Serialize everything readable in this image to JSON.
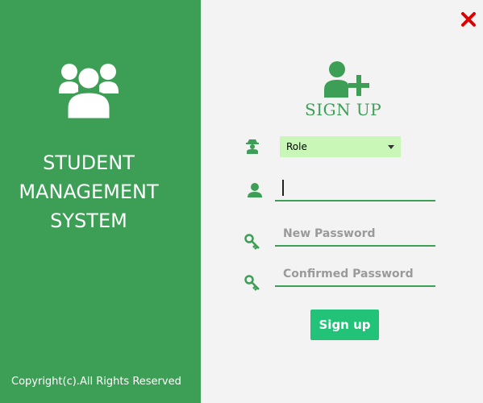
{
  "left_panel": {
    "title_lines": [
      "STUDENT",
      "MANAGEMENT",
      "SYSTEM"
    ],
    "copyright": "Copyright(c).All Rights Reserved",
    "icon": "users-group-icon"
  },
  "header": {
    "title": "SIGN UP",
    "icon": "add-user-icon"
  },
  "form": {
    "role_value": "Role",
    "username_value": "",
    "new_password_placeholder": "New Password",
    "confirm_password_placeholder": "Confirmed Password",
    "submit_label": "Sign up"
  },
  "colors": {
    "brand_green": "#3d9e56",
    "button_green": "#22c279",
    "select_bg": "#c8f7b8",
    "close_red": "#e00000"
  }
}
